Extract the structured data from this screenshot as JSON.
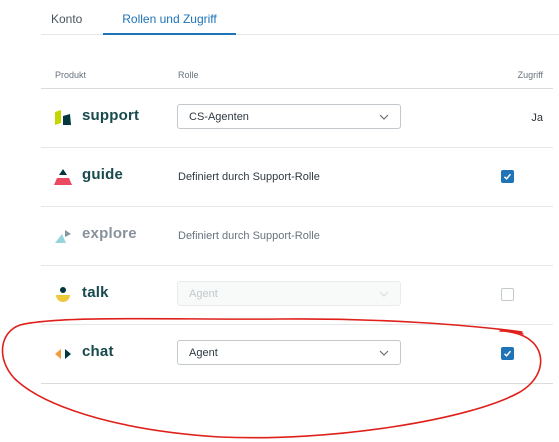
{
  "tabs": [
    {
      "label": "Konto",
      "active": false
    },
    {
      "label": "Rollen und Zugriff",
      "active": true
    }
  ],
  "table": {
    "headers": {
      "product": "Produkt",
      "role": "Rolle",
      "access": "Zugriff"
    },
    "rows": [
      {
        "product": "support",
        "role": "CS-Agenten",
        "role_type": "select",
        "access": "Ja",
        "access_type": "text",
        "logo": "support-logo-icon"
      },
      {
        "product": "guide",
        "role": "Definiert durch Support-Rolle",
        "role_type": "text",
        "access_checked": true,
        "logo": "guide-logo-icon"
      },
      {
        "product": "explore",
        "role": "Definiert durch Support-Rolle",
        "role_type": "text",
        "access_type": "none",
        "logo": "explore-logo-icon",
        "muted": true
      },
      {
        "product": "talk",
        "role": "Agent",
        "role_type": "select-disabled",
        "access_checked": false,
        "logo": "talk-logo-icon"
      },
      {
        "product": "chat",
        "role": "Agent",
        "role_type": "select",
        "access_checked": true,
        "logo": "chat-logo-icon"
      }
    ]
  },
  "colors": {
    "accent": "#1f73b7",
    "product_text": "#17494d",
    "annotation": "#e0201b"
  }
}
